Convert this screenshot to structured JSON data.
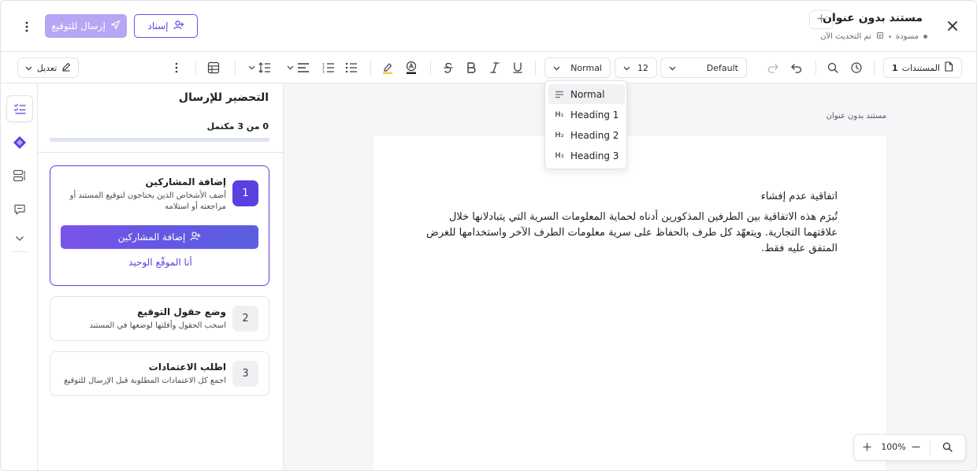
{
  "header": {
    "doc_title": "مستند بدون عنوان",
    "status": "مسودة",
    "updated": "تم التحديث الآن",
    "assign_label": "إسناد",
    "send_label": "إرسال للتوقيع"
  },
  "toolbar": {
    "documents_label": "المستندات",
    "documents_count": "1",
    "font_family": "Default",
    "font_size": "12",
    "text_style": "Normal",
    "edit_label": "تعديل"
  },
  "colors": {
    "accent": "#5b3fe0",
    "accent_disabled": "#b6a6f3",
    "progress_track": "#dde3f3"
  },
  "style_menu": {
    "items": [
      {
        "label": "Normal",
        "icon": "paragraph-icon",
        "selected": true
      },
      {
        "label": "Heading 1",
        "icon": "h1-icon",
        "glyph": "H₁"
      },
      {
        "label": "Heading 2",
        "icon": "h2-icon",
        "glyph": "H₂"
      },
      {
        "label": "Heading 3",
        "icon": "h3-icon",
        "glyph": "H₃"
      }
    ]
  },
  "panel": {
    "title": "التحضير للإرسال",
    "progress_label": "0 من 3 مكتمل",
    "progress_fraction": 0,
    "steps": [
      {
        "number": "1",
        "title": "إضافة المشاركين",
        "desc": "أضف الأشخاص الذين يحتاجون لتوقيع المستند أو مراجعته أو استلامه",
        "button": "إضافة المشاركين",
        "link": "أنا الموقّع الوحيد"
      },
      {
        "number": "2",
        "title": "وضع حقول التوقيع",
        "desc": "اسحب الحقول وأفلتها لوضعها في المستند"
      },
      {
        "number": "3",
        "title": "اطلب الاعتمادات",
        "desc": "اجمع كل الاعتمادات المطلوبة قبل الإرسال للتوقيع"
      }
    ]
  },
  "canvas": {
    "doc_label": "مستند بدون عنوان",
    "heading": "اتفاقية عدم إفشاء",
    "body": "تُبرَم هذه الاتفاقية بين الطرفين المذكورين أدناه لحماية المعلومات السرية التي يتبادلانها خلال علاقتهما التجارية. ويتعهّد كل طرف بالحفاظ على سرية معلومات الطرف الآخر واستخدامها للغرض المتفق عليه فقط."
  },
  "zoom": {
    "value": "100%"
  }
}
